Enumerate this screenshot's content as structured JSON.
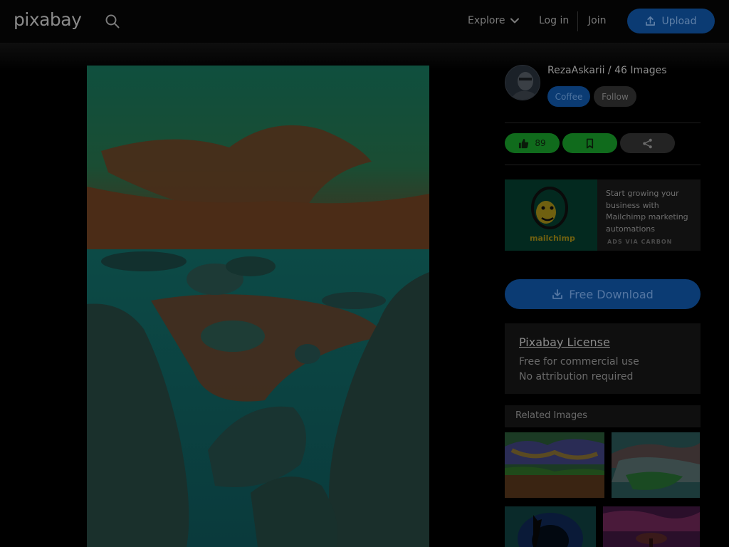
{
  "header": {
    "logo": "pixabay",
    "search_icon": "search-icon",
    "explore_label": "Explore",
    "login_label": "Log in",
    "join_label": "Join",
    "upload_label": "Upload"
  },
  "author": {
    "name": "RezaAskari",
    "images": "46 Images",
    "line": "RezaAskarii / 46 Images",
    "coffee_label": "Coffee",
    "follow_label": "Follow"
  },
  "actions": {
    "likes": "89",
    "like_icon": "thumbs-up-icon",
    "save_icon": "bookmark-icon",
    "share_icon": "share-icon"
  },
  "ad": {
    "text": "Start growing your business with Mailchimp marketing automations",
    "via": "ADS VIA CARBON",
    "brand": "mailchimp"
  },
  "download": {
    "label": "Free Download"
  },
  "license": {
    "title": "Pixabay License",
    "line1": "Free for commercial use",
    "line2": "No attribution required"
  },
  "related": {
    "title": "Related Images"
  },
  "colors": {
    "accent_blue": "#0b3b73",
    "like_green": "#106b1c",
    "background": "#000000"
  }
}
